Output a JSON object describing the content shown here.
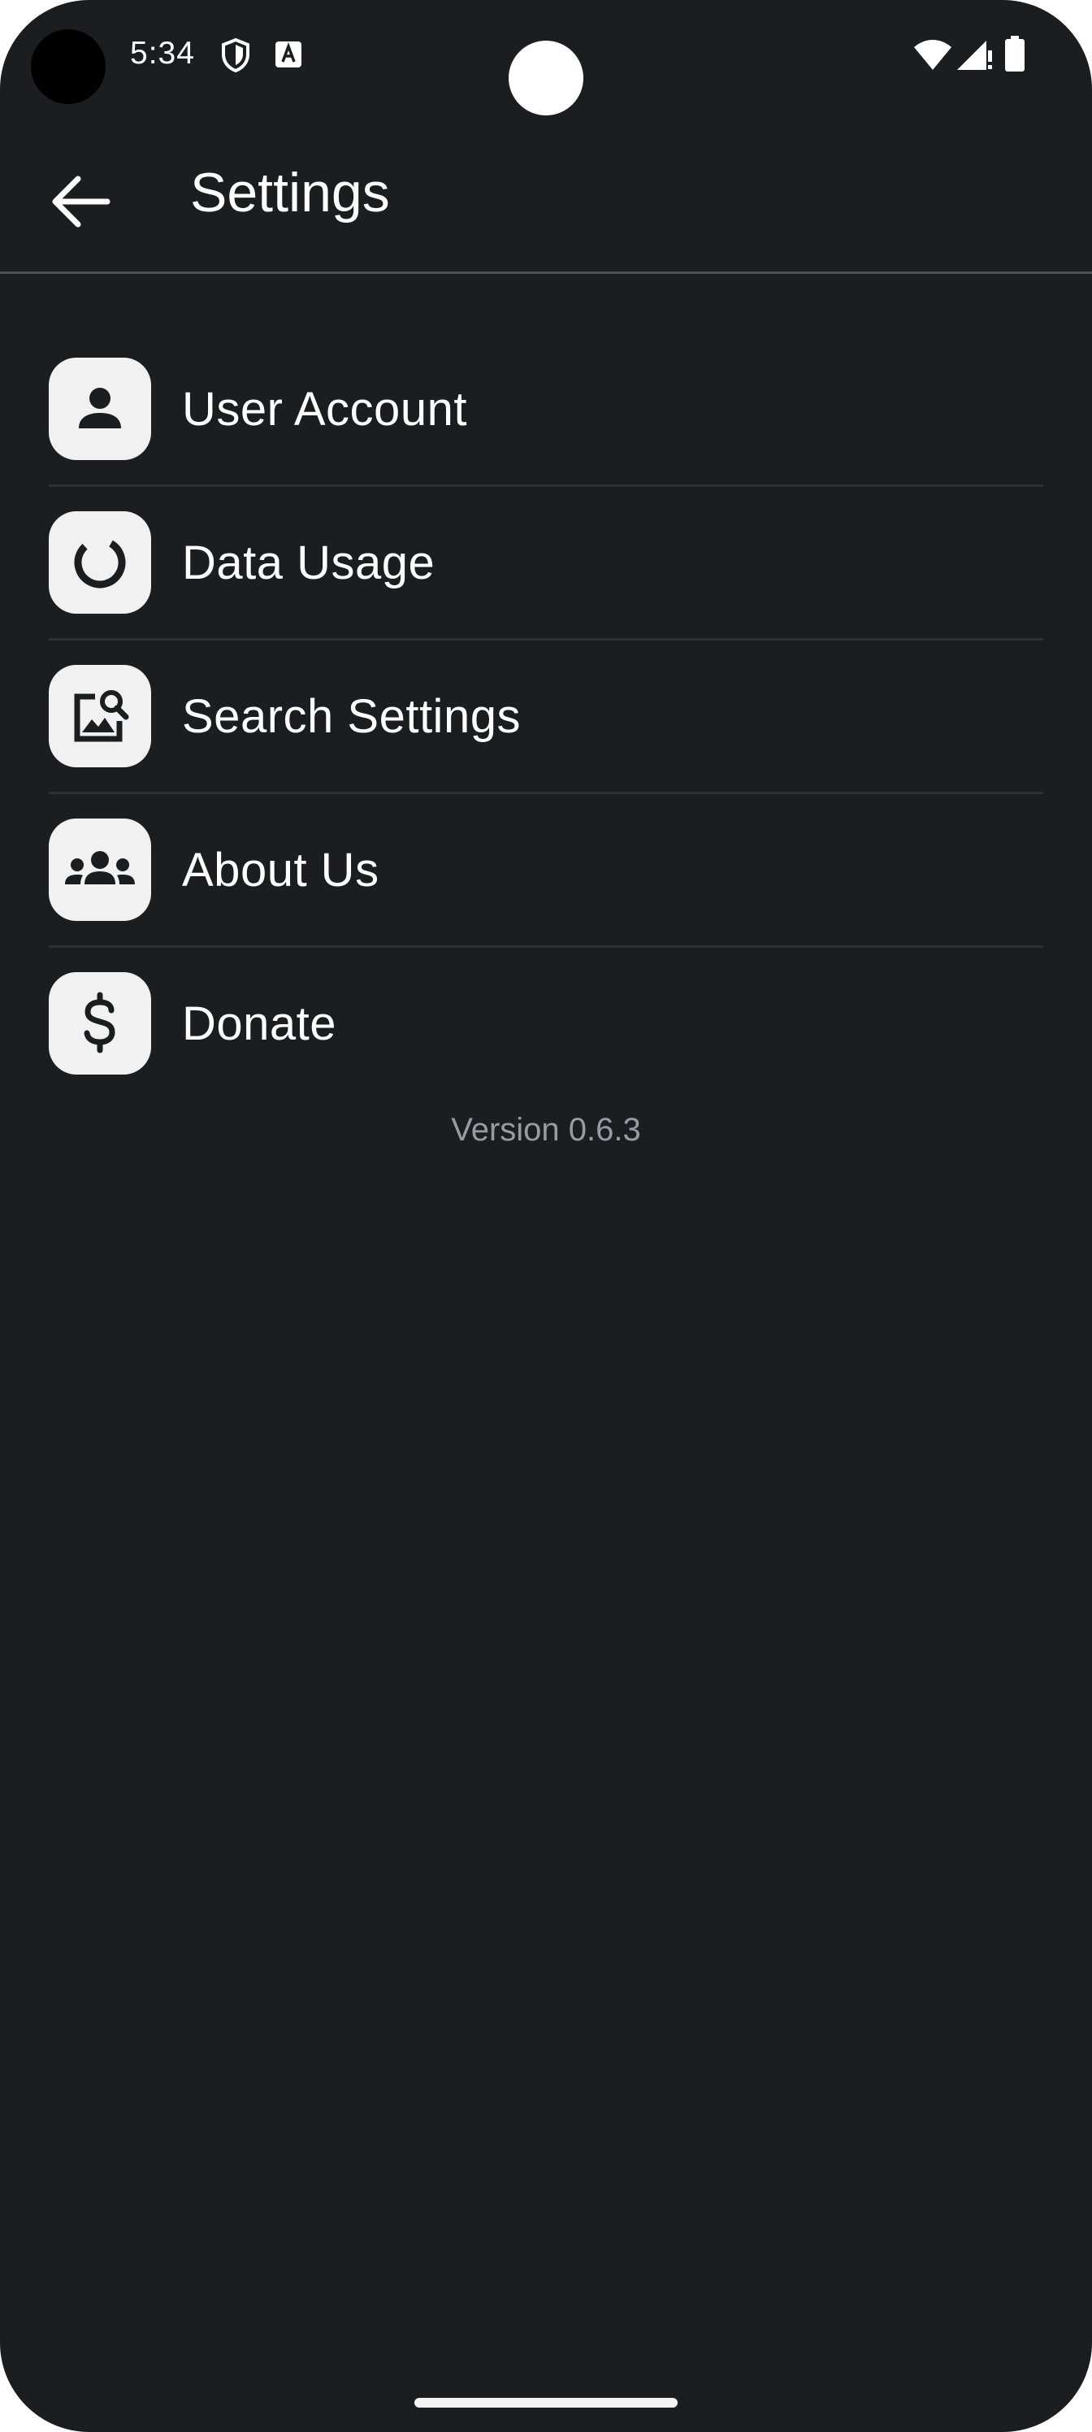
{
  "status_bar": {
    "time": "5:34",
    "icons": [
      "shield-icon",
      "a-badge-icon",
      "wifi-icon",
      "signal-icon",
      "battery-icon"
    ]
  },
  "app_bar": {
    "back_icon": "arrow-left-icon",
    "title": "Settings"
  },
  "menu": {
    "items": [
      {
        "label": "User Account",
        "icon": "person-icon"
      },
      {
        "label": "Data Usage",
        "icon": "data-usage-icon"
      },
      {
        "label": "Search Settings",
        "icon": "image-search-icon"
      },
      {
        "label": "About Us",
        "icon": "group-icon"
      },
      {
        "label": "Donate",
        "icon": "dollar-icon"
      }
    ]
  },
  "version": "Version 0.6.3",
  "colors": {
    "background": "#1c1d20",
    "text": "#ffffff",
    "icon_tile": "#f1f1f1",
    "icon_glyph": "#1c1d20",
    "divider": "#2f3034",
    "muted_text": "#9a9ba0"
  }
}
